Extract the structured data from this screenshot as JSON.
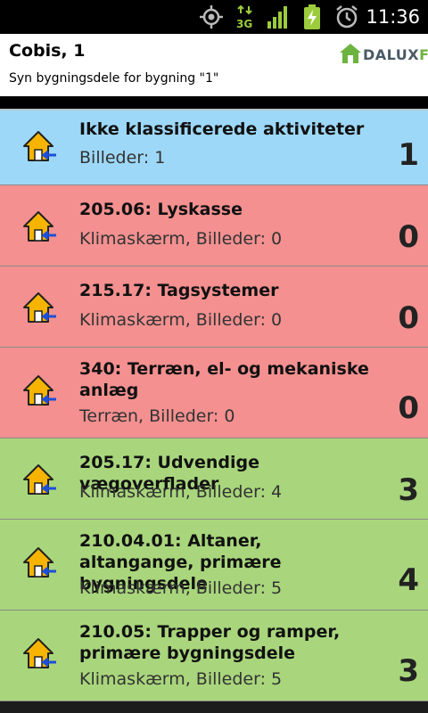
{
  "status_bar": {
    "time": "11:36",
    "icons": [
      "gps-icon",
      "3g-data-icon",
      "signal-icon",
      "battery-charging-icon",
      "alarm-icon"
    ],
    "network_label": "3G"
  },
  "header": {
    "title": "Cobis, 1",
    "subtitle": "Syn bygningsdele for bygning \"1\"",
    "logo_text_1": "DALUX",
    "logo_text_2": "FM"
  },
  "colors": {
    "row_blue": "#9ed8f8",
    "row_red": "#f49090",
    "row_green": "#a9d67c",
    "logo_green": "#6db33f"
  },
  "items": [
    {
      "name": "Ikke klassificerede aktiviteter",
      "meta": "Billeder: 1",
      "count": "1",
      "status": "blue"
    },
    {
      "name": "205.06: Lyskasse",
      "meta": "Klimaskærm, Billeder: 0",
      "count": "0",
      "status": "red"
    },
    {
      "name": "215.17: Tagsystemer",
      "meta": "Klimaskærm, Billeder: 0",
      "count": "0",
      "status": "red"
    },
    {
      "name": "340: Terræn, el- og mekaniske anlæg",
      "meta": "Terræn, Billeder: 0",
      "count": "0",
      "status": "red"
    },
    {
      "name": "205.17: Udvendige vægoverflader",
      "meta": "Klimaskærm, Billeder: 4",
      "count": "3",
      "status": "green"
    },
    {
      "name": "210.04.01: Altaner, altangange, primære bygningsdele",
      "meta": "Klimaskærm, Billeder: 5",
      "count": "4",
      "status": "green"
    },
    {
      "name": "210.05: Trapper og ramper, primære bygningsdele",
      "meta": "Klimaskærm, Billeder: 5",
      "count": "3",
      "status": "green"
    }
  ]
}
